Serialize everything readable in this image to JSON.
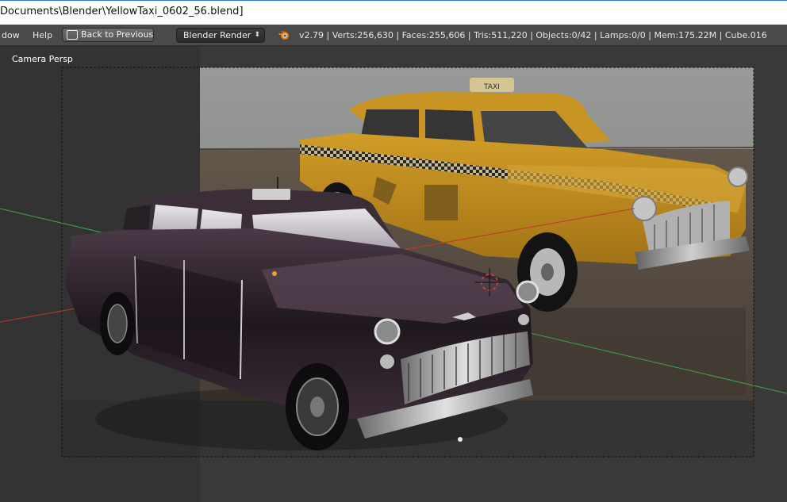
{
  "window": {
    "title": "Documents\\Blender\\YellowTaxi_0602_56.blend]"
  },
  "info_header": {
    "menu": [
      {
        "label": "dow"
      },
      {
        "label": "Help"
      }
    ],
    "back_button": {
      "label": "Back to Previous"
    },
    "render_engine": {
      "selected": "Blender Render"
    },
    "stats": "v2.79 | Verts:256,630 | Faces:255,606 | Tris:511,220 | Objects:0/42 | Lamps:0/0 | Mem:175.22M | Cube.016"
  },
  "viewport": {
    "view_label": "Camera Persp",
    "background_image": "yellow-taxi-reference-photo",
    "object": "dark-checker-taxi-model"
  },
  "colors": {
    "titlebar": "#ffffff",
    "header": "#4a4a4a",
    "viewport_bg": "#393939",
    "x_axis": "#c0392b",
    "y_axis": "#3fa34d",
    "taxi_yellow": "#e0a321",
    "taxi_body_dark": "#2a1f28"
  }
}
